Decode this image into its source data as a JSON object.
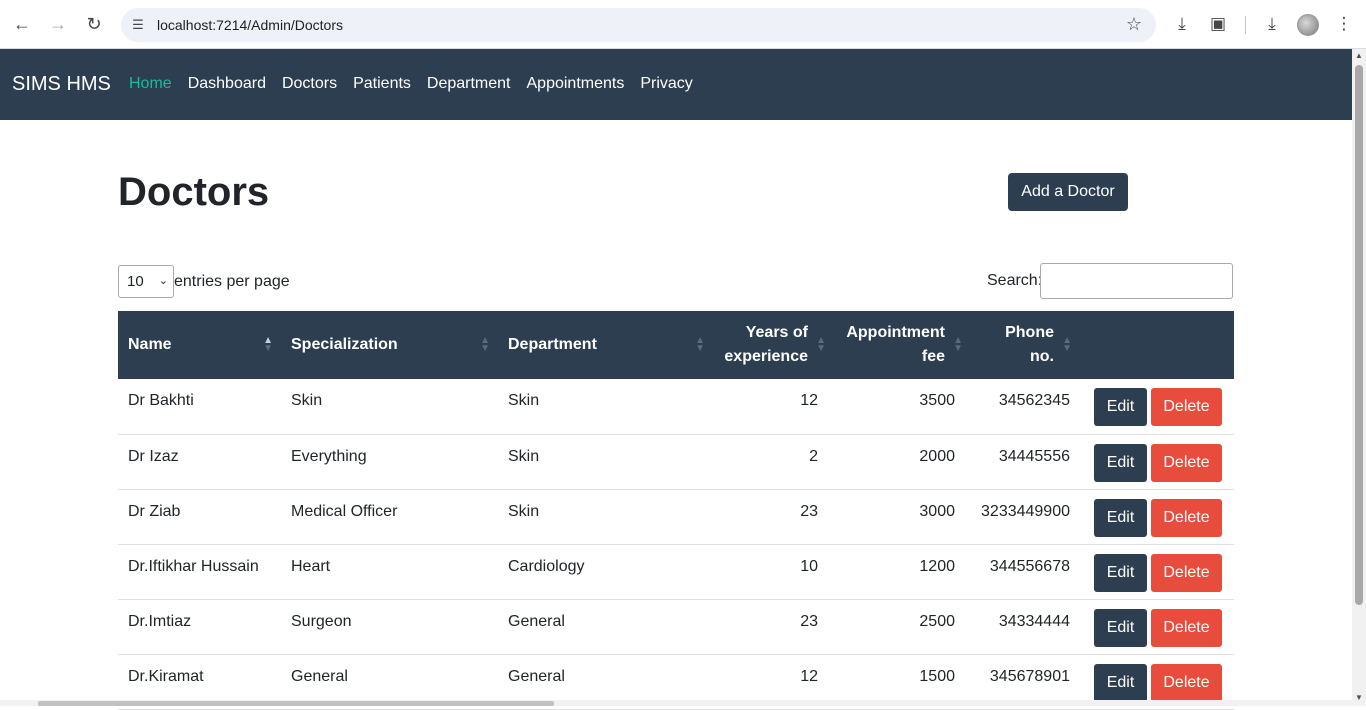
{
  "browser": {
    "url": "localhost:7214/Admin/Doctors",
    "back_icon": "arrow-left-icon",
    "forward_icon": "arrow-right-icon",
    "reload_icon": "reload-icon"
  },
  "navbar": {
    "brand": "SIMS HMS",
    "links": [
      "Home",
      "Dashboard",
      "Doctors",
      "Patients",
      "Department",
      "Appointments",
      "Privacy"
    ],
    "active_color": "#18bc9c",
    "background": "#2c3e50"
  },
  "page": {
    "title": "Doctors",
    "add_button": "Add a Doctor"
  },
  "table_controls": {
    "page_length": "10",
    "length_label": "entries per page",
    "search_label": "Search:"
  },
  "table": {
    "headers": {
      "name": "Name",
      "specialization": "Specialization",
      "department": "Department",
      "experience": "Years of experience",
      "fee": "Appointment fee",
      "phone": "Phone no."
    },
    "rows": [
      {
        "name": "Dr Bakhti",
        "specialization": "Skin",
        "department": "Skin",
        "experience": "12",
        "fee": "3500",
        "phone": "34562345"
      },
      {
        "name": "Dr Izaz",
        "specialization": "Everything",
        "department": "Skin",
        "experience": "2",
        "fee": "2000",
        "phone": "34445556"
      },
      {
        "name": "Dr Ziab",
        "specialization": "Medical Officer",
        "department": "Skin",
        "experience": "23",
        "fee": "3000",
        "phone": "3233449900"
      },
      {
        "name": "Dr.Iftikhar Hussain",
        "specialization": "Heart",
        "department": "Cardiology",
        "experience": "10",
        "fee": "1200",
        "phone": "344556678"
      },
      {
        "name": "Dr.Imtiaz",
        "specialization": "Surgeon",
        "department": "General",
        "experience": "23",
        "fee": "2500",
        "phone": "34334444"
      },
      {
        "name": "Dr.Kiramat",
        "specialization": "General",
        "department": "General",
        "experience": "12",
        "fee": "1500",
        "phone": "345678901"
      }
    ],
    "edit_label": "Edit",
    "delete_label": "Delete",
    "edit_color": "#2c3e50",
    "delete_color": "#e74c3c"
  }
}
